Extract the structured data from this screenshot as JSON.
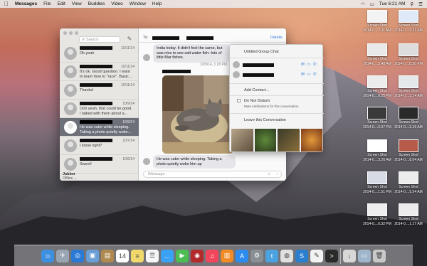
{
  "menubar": {
    "apple": "",
    "app_name": "Messages",
    "items": [
      "File",
      "Edit",
      "View",
      "Buddies",
      "Video",
      "Window",
      "Help"
    ],
    "clock": "Tue 6:21 AM"
  },
  "desktop": {
    "icons": [
      {
        "label": "Screen Shot",
        "sub": "2014-0....7.11 AM",
        "color": "#f3f3f3"
      },
      {
        "label": "Screen Shot",
        "sub": "2014-0....9.21 AM",
        "color": "#dfe9f7"
      },
      {
        "label": "Screen Shot",
        "sub": "2014-0....5.48 AM",
        "color": "#e9e9e9"
      },
      {
        "label": "Screen Shot",
        "sub": "2014-0....8.20 PM",
        "color": "#dddddd"
      },
      {
        "label": "Screen Shot",
        "sub": "2014-0....6.25 PM",
        "color": "#ececec"
      },
      {
        "label": "Screen Shot",
        "sub": "2014-0....3.14 AM",
        "color": "#e5e8ea"
      },
      {
        "label": "Screen Shot",
        "sub": "2014-0....6.07 PM",
        "color": "#3a3a3a"
      },
      {
        "label": "Screen Shot",
        "sub": "2014-0....3.19 AM",
        "color": "#2a2a2a"
      },
      {
        "label": "Screen Shot",
        "sub": "2014-0....3.26 AM",
        "color": "#ffffff"
      },
      {
        "label": "Screen Shot",
        "sub": "2014-0....8.04 AM",
        "color": "#b65a4a"
      },
      {
        "label": "Screen Shot",
        "sub": "2014-0....1.51 PM",
        "color": "#d6dbe6"
      },
      {
        "label": "Screen Shot",
        "sub": "2014-0....5.54 AM",
        "color": "#ececec"
      },
      {
        "label": "Screen Shot",
        "sub": "2014-0....6.32 PM",
        "color": "#eeeeee"
      },
      {
        "label": "Screen Shot",
        "sub": "2014-0....1.17 AM",
        "color": "#ececec"
      }
    ]
  },
  "sidebar": {
    "search_placeholder": "Search",
    "conversations": [
      {
        "date": "10/11/14",
        "preview": "Ok yeah"
      },
      {
        "date": "10/11/14",
        "preview": "It's ok.  Good question.  I want to learn how to \"race\". Basic..."
      },
      {
        "date": "10/11/14",
        "preview": "Thanks!"
      },
      {
        "date": "10/9/14",
        "preview": "Ooh yeah, that could be good. I talked with them about a..."
      },
      {
        "date": "10/9/14",
        "preview": "He was cuter while sleeping. Taking a photo quietly woke..."
      },
      {
        "date": "10/7/14",
        "preview": "I know right?"
      },
      {
        "date": "10/6/14",
        "preview": "Sweet!"
      }
    ],
    "account": "Jabber",
    "status": "Offline"
  },
  "chat": {
    "to_label": "To:",
    "details_label": "Details",
    "incoming_text": "India today. It didn't feel the same, but was nice to see salt water fish--lots of little Mar fishes.",
    "timestamp": "10/9/14, 1:28 PM",
    "reply_text": "He was cuter while sleeping. Taking a photo quietly woke him up",
    "input_placeholder": "iMessage"
  },
  "details": {
    "group_name": "Untitled Group Chat",
    "add_contact": "Add Contact...",
    "dnd_label": "Do Not Disturb",
    "dnd_sub": "Mute notifications for this conversation",
    "leave": "Leave this Conversation"
  },
  "dock": {
    "apps": [
      {
        "name": "Finder",
        "color": "#3d8fe0",
        "glyph": "☺"
      },
      {
        "name": "Launchpad",
        "color": "#9aa5b3",
        "glyph": "✈"
      },
      {
        "name": "Safari",
        "color": "#2a7ad6",
        "glyph": "◎"
      },
      {
        "name": "Preview",
        "color": "#6a9fd6",
        "glyph": "▣"
      },
      {
        "name": "Contacts",
        "color": "#b0894f",
        "glyph": "▤"
      },
      {
        "name": "Calendar",
        "color": "#ffffff",
        "glyph": "14"
      },
      {
        "name": "Notes",
        "color": "#f1d86a",
        "glyph": "≡"
      },
      {
        "name": "Reminders",
        "color": "#f6f6f6",
        "glyph": "☰"
      },
      {
        "name": "Messages",
        "color": "#3aa2f5",
        "glyph": "…"
      },
      {
        "name": "FaceTime",
        "color": "#4bbd53",
        "glyph": "▶"
      },
      {
        "name": "Photo Booth",
        "color": "#b22a2a",
        "glyph": "◉"
      },
      {
        "name": "iTunes",
        "color": "#f2465d",
        "glyph": "♫"
      },
      {
        "name": "iBooks",
        "color": "#f28a25",
        "glyph": "▥"
      },
      {
        "name": "App Store",
        "color": "#2c8cf0",
        "glyph": "A"
      },
      {
        "name": "System Preferences",
        "color": "#8a8f96",
        "glyph": "⚙"
      },
      {
        "name": "Twitter",
        "color": "#4aa3e0",
        "glyph": "t"
      },
      {
        "name": "Chrome",
        "color": "#e0e0e0",
        "glyph": "◍"
      },
      {
        "name": "Skype",
        "color": "#2a7fcf",
        "glyph": "S"
      },
      {
        "name": "TextEdit",
        "color": "#f2f2f2",
        "glyph": "✎"
      },
      {
        "name": "Terminal",
        "color": "#2a2a2a",
        "glyph": ">"
      },
      {
        "name": "Downloads",
        "color": "#d7d7d7",
        "glyph": "↓"
      },
      {
        "name": "Folder",
        "color": "#9fb5cc",
        "glyph": "▭"
      },
      {
        "name": "Trash",
        "color": "#c9c9c9",
        "glyph": "🗑"
      }
    ]
  }
}
